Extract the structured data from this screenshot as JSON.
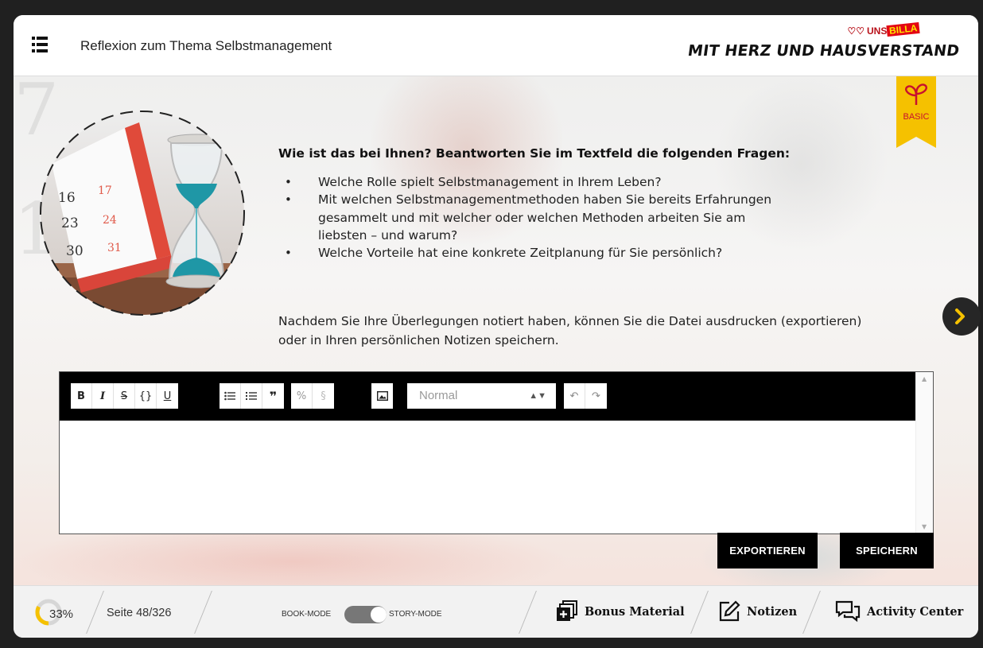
{
  "header": {
    "title": "Reflexion zum Thema Selbstmanagement",
    "logo_top": "UNSER",
    "logo_brand": "BILLA",
    "logo_main": "MIT HERZ UND HAUSVERSTAND"
  },
  "badge": {
    "label": "BASIC"
  },
  "image": {
    "calendar_numbers": [
      "16",
      "17",
      "23",
      "24",
      "30",
      "31"
    ]
  },
  "content": {
    "question": "Wie ist das bei Ihnen? Beantworten Sie im Textfeld die folgenden Fragen:",
    "bullets": [
      "Welche Rolle spielt Selbstmanagement in Ihrem Leben?",
      "Mit welchen Selbstmanagementmethoden haben Sie bereits Erfahrungen gesammelt und mit welcher oder welchen Methoden arbeiten Sie am liebsten – und warum?",
      "Welche Vorteile hat eine konkrete Zeitplanung für Sie persönlich?"
    ],
    "note": "Nachdem Sie Ihre Überlegungen notiert haben, können Sie die Datei ausdrucken (exportieren) oder in Ihren persönlichen Notizen speichern."
  },
  "editor": {
    "format_select": "Normal",
    "text": ""
  },
  "buttons": {
    "export": "EXPORTIEREN",
    "save": "SPEICHERN"
  },
  "footer": {
    "progress_label": "33%",
    "progress_value": 0.33,
    "page": "Seite 48/326",
    "mode_left": "BOOK-MODE",
    "mode_right": "STORY-MODE",
    "bonus": "Bonus Material",
    "notes": "Notizen",
    "activity": "Activity Center"
  },
  "colors": {
    "accent": "#f5c100",
    "brand_red": "#e30613",
    "toolbar": "#000000"
  }
}
